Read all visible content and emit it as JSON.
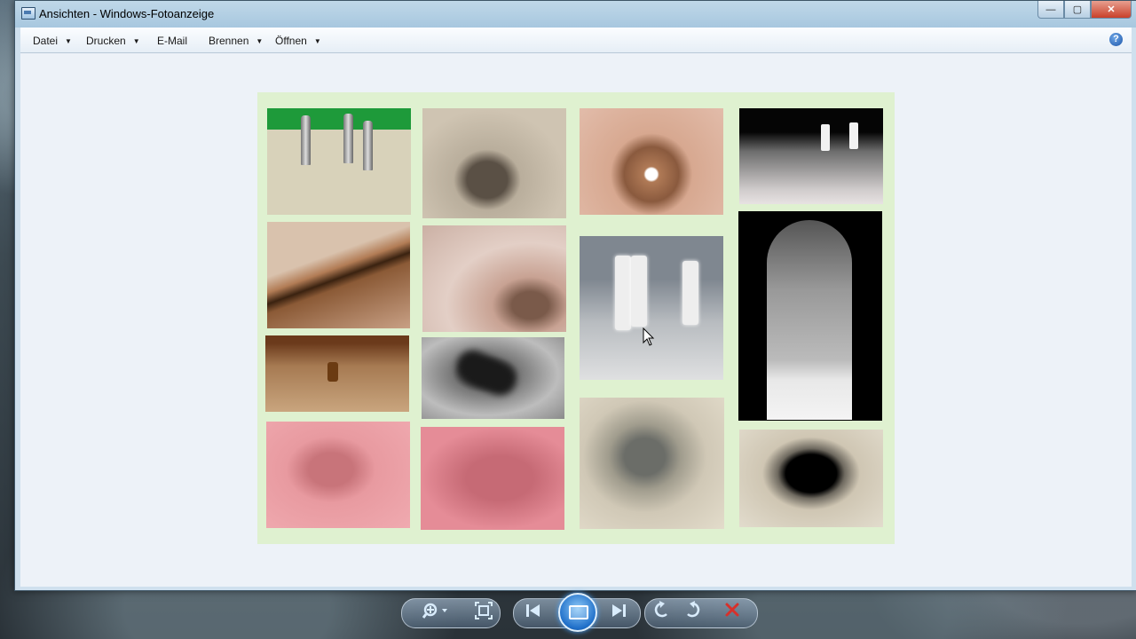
{
  "window": {
    "title": "Ansichten - Windows-Fotoanzeige",
    "controls": {
      "minimize": "—",
      "maximize": "▢",
      "close": "✕"
    }
  },
  "menu": {
    "items": [
      {
        "label": "Datei",
        "has_dropdown": true
      },
      {
        "label": "Drucken",
        "has_dropdown": true
      },
      {
        "label": "E-Mail",
        "has_dropdown": false
      },
      {
        "label": "Brennen",
        "has_dropdown": true
      },
      {
        "label": "Öffnen",
        "has_dropdown": true
      }
    ],
    "help_label": "?"
  },
  "toolbar": {
    "zoom_icon": "magnifier-icon",
    "fit_icon": "fit-window-icon",
    "prev_icon": "previous-icon",
    "slideshow_icon": "slideshow-icon",
    "next_icon": "next-icon",
    "rotate_left_icon": "rotate-left-icon",
    "rotate_right_icon": "rotate-right-icon",
    "delete_icon": "delete-icon"
  },
  "colors": {
    "panel_background": "#dff1d0",
    "viewer_background": "#edf2f8",
    "delete_red": "#d8302a"
  }
}
